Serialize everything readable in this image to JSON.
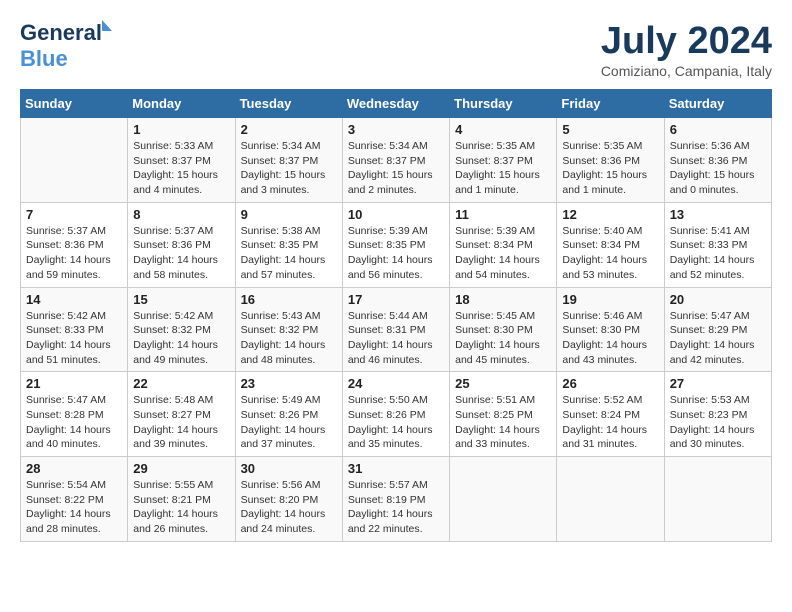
{
  "header": {
    "logo_line1": "General",
    "logo_line2": "Blue",
    "month_title": "July 2024",
    "location": "Comiziano, Campania, Italy"
  },
  "weekdays": [
    "Sunday",
    "Monday",
    "Tuesday",
    "Wednesday",
    "Thursday",
    "Friday",
    "Saturday"
  ],
  "weeks": [
    [
      {
        "day": "",
        "info": ""
      },
      {
        "day": "1",
        "info": "Sunrise: 5:33 AM\nSunset: 8:37 PM\nDaylight: 15 hours\nand 4 minutes."
      },
      {
        "day": "2",
        "info": "Sunrise: 5:34 AM\nSunset: 8:37 PM\nDaylight: 15 hours\nand 3 minutes."
      },
      {
        "day": "3",
        "info": "Sunrise: 5:34 AM\nSunset: 8:37 PM\nDaylight: 15 hours\nand 2 minutes."
      },
      {
        "day": "4",
        "info": "Sunrise: 5:35 AM\nSunset: 8:37 PM\nDaylight: 15 hours\nand 1 minute."
      },
      {
        "day": "5",
        "info": "Sunrise: 5:35 AM\nSunset: 8:36 PM\nDaylight: 15 hours\nand 1 minute."
      },
      {
        "day": "6",
        "info": "Sunrise: 5:36 AM\nSunset: 8:36 PM\nDaylight: 15 hours\nand 0 minutes."
      }
    ],
    [
      {
        "day": "7",
        "info": "Sunrise: 5:37 AM\nSunset: 8:36 PM\nDaylight: 14 hours\nand 59 minutes."
      },
      {
        "day": "8",
        "info": "Sunrise: 5:37 AM\nSunset: 8:36 PM\nDaylight: 14 hours\nand 58 minutes."
      },
      {
        "day": "9",
        "info": "Sunrise: 5:38 AM\nSunset: 8:35 PM\nDaylight: 14 hours\nand 57 minutes."
      },
      {
        "day": "10",
        "info": "Sunrise: 5:39 AM\nSunset: 8:35 PM\nDaylight: 14 hours\nand 56 minutes."
      },
      {
        "day": "11",
        "info": "Sunrise: 5:39 AM\nSunset: 8:34 PM\nDaylight: 14 hours\nand 54 minutes."
      },
      {
        "day": "12",
        "info": "Sunrise: 5:40 AM\nSunset: 8:34 PM\nDaylight: 14 hours\nand 53 minutes."
      },
      {
        "day": "13",
        "info": "Sunrise: 5:41 AM\nSunset: 8:33 PM\nDaylight: 14 hours\nand 52 minutes."
      }
    ],
    [
      {
        "day": "14",
        "info": "Sunrise: 5:42 AM\nSunset: 8:33 PM\nDaylight: 14 hours\nand 51 minutes."
      },
      {
        "day": "15",
        "info": "Sunrise: 5:42 AM\nSunset: 8:32 PM\nDaylight: 14 hours\nand 49 minutes."
      },
      {
        "day": "16",
        "info": "Sunrise: 5:43 AM\nSunset: 8:32 PM\nDaylight: 14 hours\nand 48 minutes."
      },
      {
        "day": "17",
        "info": "Sunrise: 5:44 AM\nSunset: 8:31 PM\nDaylight: 14 hours\nand 46 minutes."
      },
      {
        "day": "18",
        "info": "Sunrise: 5:45 AM\nSunset: 8:30 PM\nDaylight: 14 hours\nand 45 minutes."
      },
      {
        "day": "19",
        "info": "Sunrise: 5:46 AM\nSunset: 8:30 PM\nDaylight: 14 hours\nand 43 minutes."
      },
      {
        "day": "20",
        "info": "Sunrise: 5:47 AM\nSunset: 8:29 PM\nDaylight: 14 hours\nand 42 minutes."
      }
    ],
    [
      {
        "day": "21",
        "info": "Sunrise: 5:47 AM\nSunset: 8:28 PM\nDaylight: 14 hours\nand 40 minutes."
      },
      {
        "day": "22",
        "info": "Sunrise: 5:48 AM\nSunset: 8:27 PM\nDaylight: 14 hours\nand 39 minutes."
      },
      {
        "day": "23",
        "info": "Sunrise: 5:49 AM\nSunset: 8:26 PM\nDaylight: 14 hours\nand 37 minutes."
      },
      {
        "day": "24",
        "info": "Sunrise: 5:50 AM\nSunset: 8:26 PM\nDaylight: 14 hours\nand 35 minutes."
      },
      {
        "day": "25",
        "info": "Sunrise: 5:51 AM\nSunset: 8:25 PM\nDaylight: 14 hours\nand 33 minutes."
      },
      {
        "day": "26",
        "info": "Sunrise: 5:52 AM\nSunset: 8:24 PM\nDaylight: 14 hours\nand 31 minutes."
      },
      {
        "day": "27",
        "info": "Sunrise: 5:53 AM\nSunset: 8:23 PM\nDaylight: 14 hours\nand 30 minutes."
      }
    ],
    [
      {
        "day": "28",
        "info": "Sunrise: 5:54 AM\nSunset: 8:22 PM\nDaylight: 14 hours\nand 28 minutes."
      },
      {
        "day": "29",
        "info": "Sunrise: 5:55 AM\nSunset: 8:21 PM\nDaylight: 14 hours\nand 26 minutes."
      },
      {
        "day": "30",
        "info": "Sunrise: 5:56 AM\nSunset: 8:20 PM\nDaylight: 14 hours\nand 24 minutes."
      },
      {
        "day": "31",
        "info": "Sunrise: 5:57 AM\nSunset: 8:19 PM\nDaylight: 14 hours\nand 22 minutes."
      },
      {
        "day": "",
        "info": ""
      },
      {
        "day": "",
        "info": ""
      },
      {
        "day": "",
        "info": ""
      }
    ]
  ]
}
